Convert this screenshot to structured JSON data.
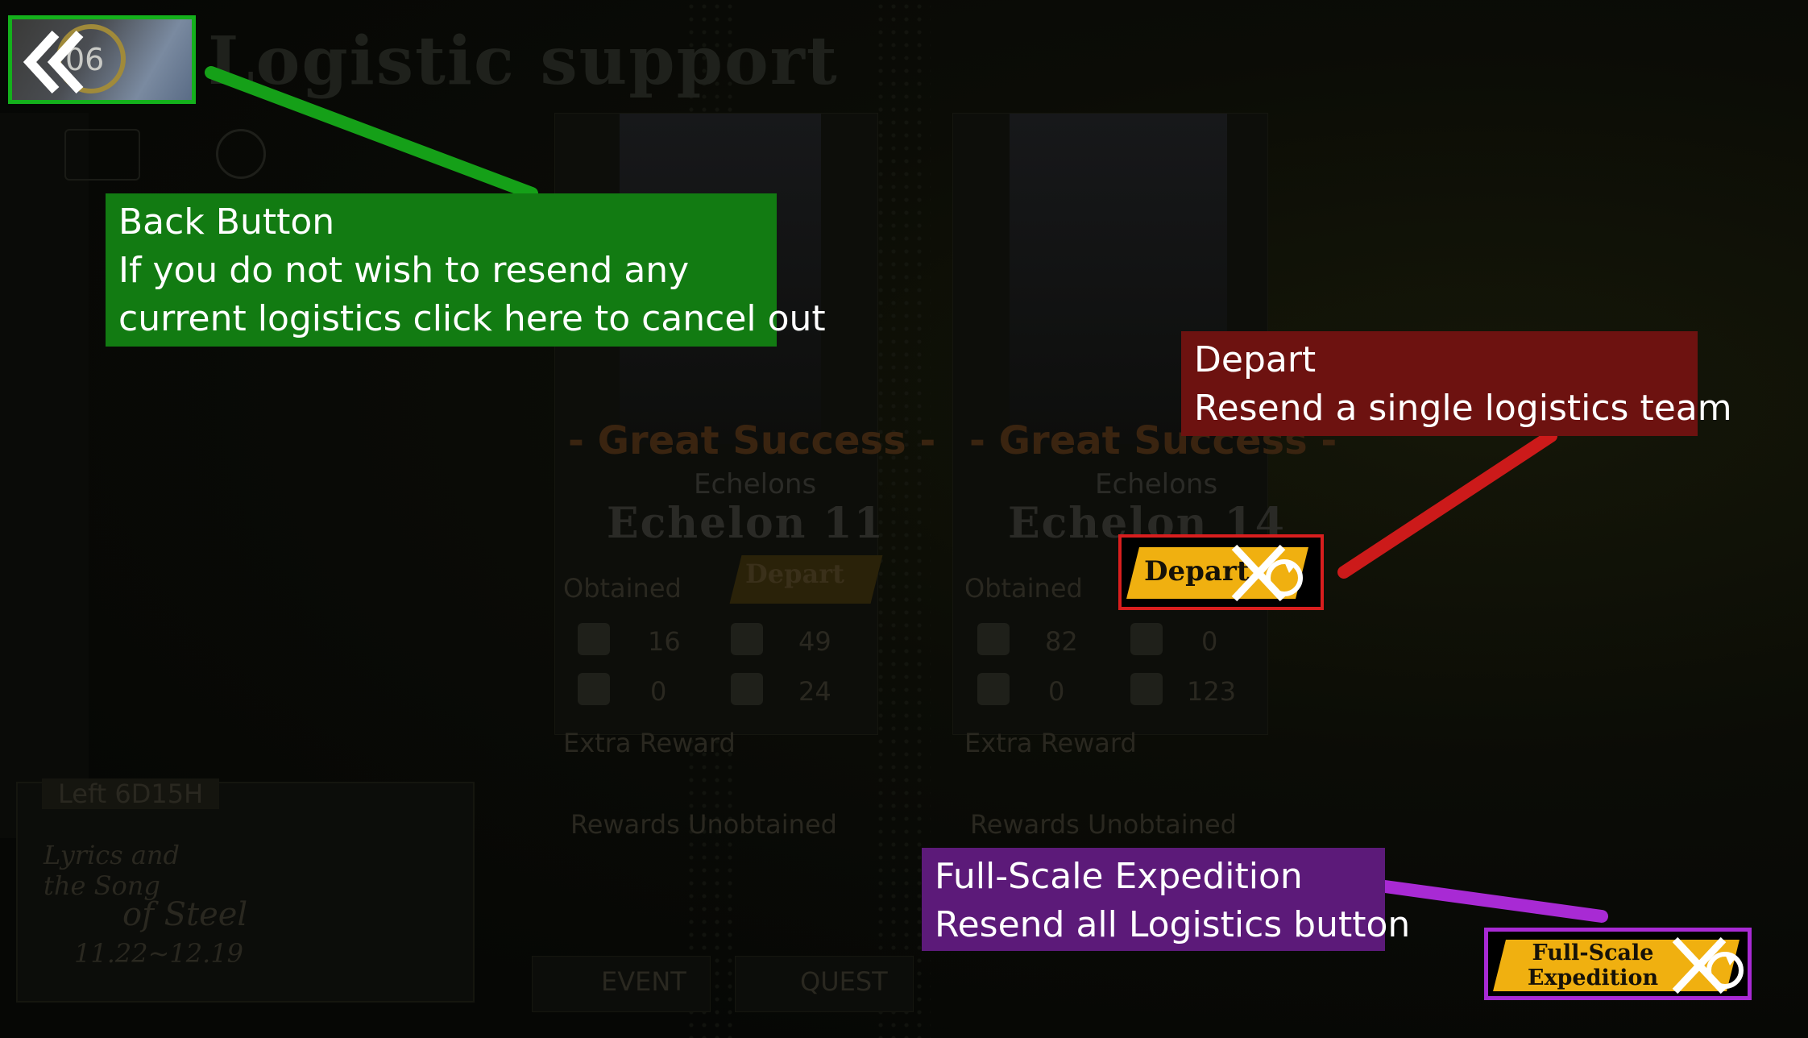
{
  "screen": {
    "title": "Logistic  support",
    "timer_label": "Left 6D15H"
  },
  "back_button": {
    "icon": "double-chevron-left-icon",
    "badge": "06"
  },
  "cards": [
    {
      "result": "- Great Success -",
      "echelons_label": "Echelons",
      "echelon_name": "Echelon  11",
      "depart_label": "Depart",
      "obtained_label": "Obtained",
      "resources": {
        "manpower": "16",
        "ammo": "49",
        "parts": "0",
        "rations": "24"
      },
      "extra_reward_label": "Extra Reward",
      "rewards_unobtained_label": "Rewards Unobtained"
    },
    {
      "result": "- Great Success -",
      "echelons_label": "Echelons",
      "echelon_name": "Echelon  14",
      "depart_label": "Depart",
      "obtained_label": "Obtained",
      "resources": {
        "manpower": "82",
        "ammo": "0",
        "parts": "0",
        "rations": "123"
      },
      "extra_reward_label": "Extra Reward",
      "rewards_unobtained_label": "Rewards Unobtained"
    }
  ],
  "banner": {
    "line1": "Lyrics and",
    "line2": "the Song",
    "line3": "of Steel",
    "dates": "11.22~12.19"
  },
  "bottom_nav": {
    "event": "EVENT",
    "quest": "QUEST"
  },
  "full_scale_button": {
    "line1": "Full-Scale",
    "line2": "Expedition"
  },
  "callouts": {
    "back": {
      "line1": "Back Button",
      "line2": "If you do not wish to resend any",
      "line3": "current logistics click here to cancel out"
    },
    "depart": {
      "line1": "Depart",
      "line2": "Resend a single logistics team"
    },
    "full_scale": {
      "line1": "Full-Scale Expedition",
      "line2": "Resend all Logistics button"
    }
  },
  "colors": {
    "green": "#127b12",
    "red": "#6d1210",
    "purple": "#5c1a79",
    "button_yellow": "#f0b010",
    "green_line": "#15a018",
    "red_line": "#cc1a1a",
    "purple_line": "#a82ad4"
  }
}
